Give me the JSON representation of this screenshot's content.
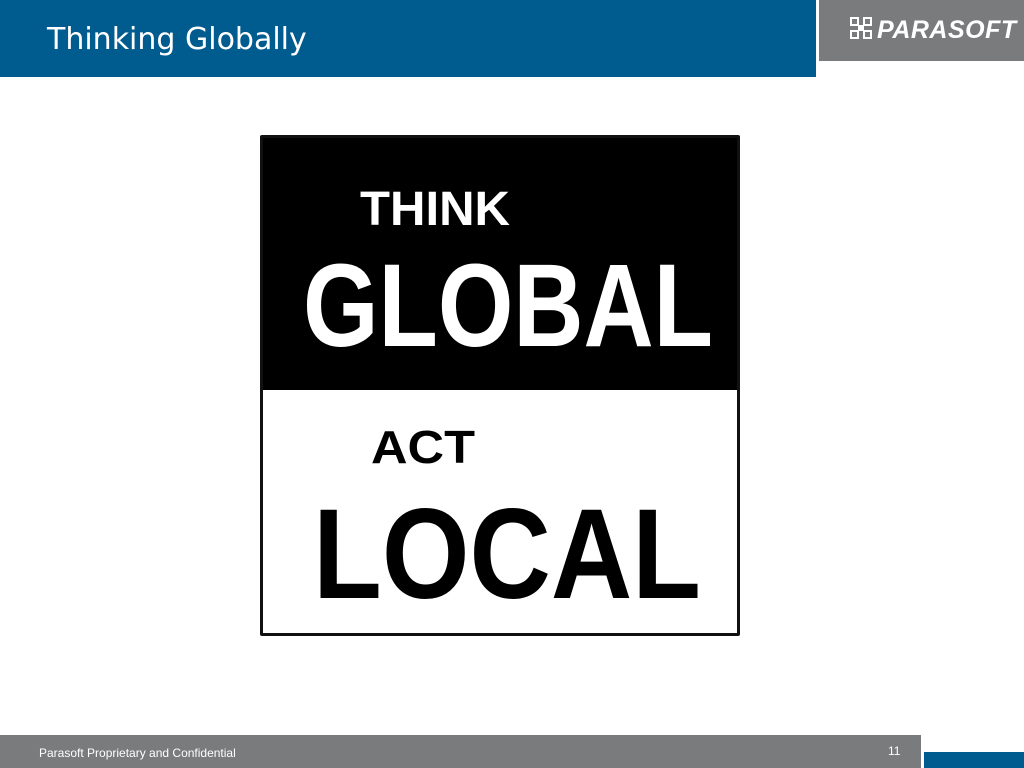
{
  "slide": {
    "title": "Thinking Globally",
    "logo_text": "PARASOFT",
    "poster": {
      "line1": "THINK",
      "line2": "GLOBAL",
      "line3": "ACT",
      "line4": "LOCAL",
      "top_color": "#000000",
      "bottom_color": "#ffffff"
    },
    "footer_text": "Parasoft Proprietary and Confidential",
    "page_number": "11"
  },
  "colors": {
    "brand_blue": "#005b8f",
    "footer_gray": "#7a7b7d"
  }
}
